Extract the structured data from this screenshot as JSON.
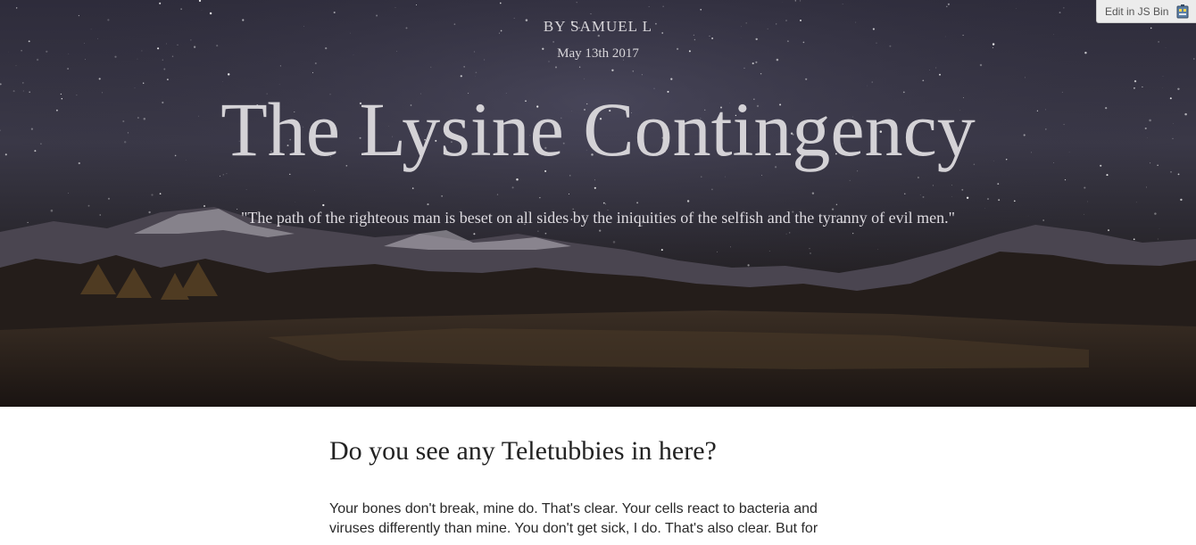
{
  "hero": {
    "byline": "BY SAMUEL L",
    "date": "May 13th 2017",
    "title": "The Lysine Contingency",
    "quote": "\"The path of the righteous man is beset on all sides by the iniquities of the selfish and the tyranny of evil men.\""
  },
  "jsbin": {
    "label": "Edit in JS Bin",
    "icon": "jsbin-icon"
  },
  "article": {
    "heading": "Do you see any Teletubbies in here?",
    "body": "Your bones don't break, mine do. That's clear. Your cells react to bacteria and viruses differently than mine. You don't get sick, I do. That's also clear. But for"
  },
  "colors": {
    "sky": "#2e2c3b",
    "title_text": "#d4d2d6",
    "body_text": "#2a2a2a"
  }
}
